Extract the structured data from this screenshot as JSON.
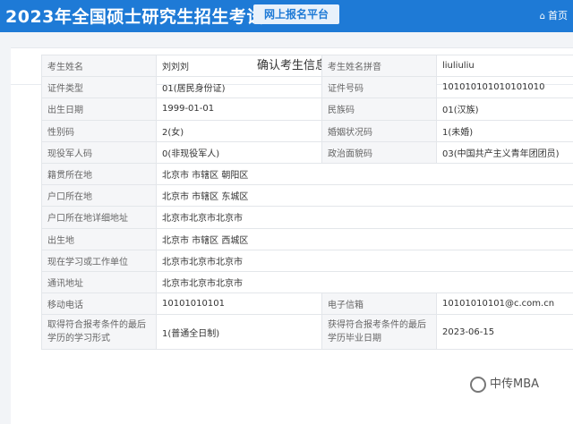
{
  "header": {
    "title": "2023年全国硕士研究生招生考试",
    "platform": "网上报名平台",
    "home": "首页"
  },
  "card": {
    "title": "确认考生信息"
  },
  "rows": [
    {
      "l1": "考生姓名",
      "v1": "刘刘刘",
      "l2": "考生姓名拼音",
      "v2": "liuliuliu"
    },
    {
      "l1": "证件类型",
      "v1": "01(居民身份证)",
      "l2": "证件号码",
      "v2": "101010101010101010"
    },
    {
      "l1": "出生日期",
      "v1": "1999-01-01",
      "l2": "民族码",
      "v2": "01(汉族)"
    },
    {
      "l1": "性别码",
      "v1": "2(女)",
      "l2": "婚姻状况码",
      "v2": "1(未婚)"
    },
    {
      "l1": "现役军人码",
      "v1": "0(非现役军人)",
      "l2": "政治面貌码",
      "v2": "03(中国共产主义青年团团员)"
    },
    {
      "l1": "籍贯所在地",
      "v1": "北京市 市辖区 朝阳区"
    },
    {
      "l1": "户口所在地",
      "v1": "北京市 市辖区 东城区"
    },
    {
      "l1": "户口所在地详细地址",
      "v1": "北京市北京市北京市"
    },
    {
      "l1": "出生地",
      "v1": "北京市 市辖区 西城区"
    },
    {
      "l1": "现在学习或工作单位",
      "v1": "北京市北京市北京市"
    },
    {
      "l1": "通讯地址",
      "v1": "北京市北京市北京市"
    },
    {
      "l1": "移动电话",
      "v1": "10101010101",
      "l2": "电子信箱",
      "v2": "10101010101@c.com.cn"
    },
    {
      "l1": "取得符合报考条件的最后学历的学习形式",
      "v1": "1(普通全日制)",
      "l2": "获得符合报考条件的最后学历毕业日期",
      "v2": "2023-06-15"
    }
  ],
  "watermark": "中传MBA"
}
